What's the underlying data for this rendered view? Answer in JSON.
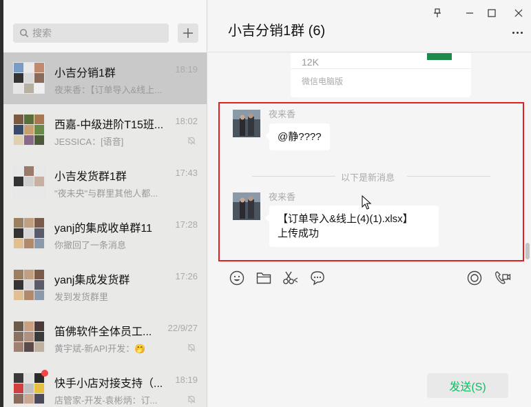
{
  "search": {
    "placeholder": "搜索"
  },
  "chats": [
    {
      "name": "小吉分销1群",
      "time": "18:19",
      "preview": "夜来香：【订单导入&线上...",
      "active": true,
      "muted": false,
      "unread": false
    },
    {
      "name": "西嘉-中级进阶T15班...",
      "time": "18:02",
      "preview": "JESSICA：[语音]",
      "active": false,
      "muted": true,
      "unread": false
    },
    {
      "name": "小吉发货群1群",
      "time": "17:43",
      "preview": "\"夜未央\"与群里其他人都...",
      "active": false,
      "muted": false,
      "unread": false
    },
    {
      "name": "yanj的集成收单群11",
      "time": "17:28",
      "preview": "你撤回了一条消息",
      "active": false,
      "muted": false,
      "unread": false
    },
    {
      "name": "yanj集成发货群",
      "time": "17:26",
      "preview": "发到发货群里",
      "active": false,
      "muted": false,
      "unread": false
    },
    {
      "name": "笛佛软件全体员工...",
      "time": "22/9/27",
      "preview": "黄宇斌-新API开发：🤭",
      "active": false,
      "muted": true,
      "unread": false
    },
    {
      "name": "快手小店对接支持（...",
      "time": "18:19",
      "preview": "店管家-开发-袁彬炳：订...",
      "active": false,
      "muted": true,
      "unread": true
    }
  ],
  "chat": {
    "title": "小吉分销1群 (6)",
    "file_card": {
      "size": "12K",
      "source": "微信电脑版"
    },
    "messages": [
      {
        "sender": "夜来香",
        "text": "@静????"
      },
      {
        "sender": "夜来香",
        "text_line1": "【订单导入&线上(4)(1).xlsx】",
        "text_line2": "上传成功"
      }
    ],
    "divider": "以下是新消息",
    "send_label": "发送(S)"
  },
  "colors": {
    "accent": "#07c160",
    "highlight": "#e01f1f",
    "active_row": "#c9c9c9"
  },
  "icons": [
    "search-icon",
    "plus-icon",
    "pin-icon",
    "minimize-icon",
    "maximize-icon",
    "close-icon",
    "more-icon",
    "emoji-icon",
    "folder-icon",
    "scissors-icon",
    "chat-bubble-icon",
    "live-icon",
    "video-call-icon",
    "mute-icon",
    "cursor-icon"
  ]
}
